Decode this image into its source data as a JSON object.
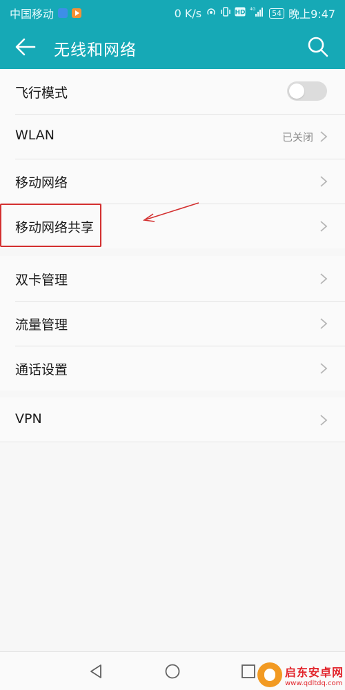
{
  "status_bar": {
    "carrier": "中国移动",
    "speed": "0 K/s",
    "network": "4G",
    "battery": "54",
    "time": "晚上9:47"
  },
  "app_bar": {
    "title": "无线和网络",
    "back_icon": "back-arrow-icon",
    "search_icon": "search-icon"
  },
  "settings_groups": [
    {
      "items": [
        {
          "label": "飞行模式",
          "control": "toggle",
          "state": "off"
        },
        {
          "label": "WLAN",
          "value": "已关闭",
          "control": "chevron"
        },
        {
          "label": "移动网络",
          "control": "chevron"
        },
        {
          "label": "移动网络共享",
          "control": "chevron",
          "highlighted": true
        }
      ]
    },
    {
      "items": [
        {
          "label": "双卡管理",
          "control": "chevron"
        },
        {
          "label": "流量管理",
          "control": "chevron"
        },
        {
          "label": "通话设置",
          "control": "chevron"
        }
      ]
    },
    {
      "items": [
        {
          "label": "VPN",
          "control": "chevron"
        }
      ]
    }
  ],
  "nav_bar": {
    "back": "triangle-back-icon",
    "home": "circle-home-icon",
    "recent": "square-recent-icon"
  },
  "watermark": {
    "title": "启东安卓网",
    "url": "www.qdltdq.com"
  },
  "colors": {
    "accent": "#16a9b6",
    "annotation": "#d32f2f",
    "watermark": "#e2242b"
  }
}
